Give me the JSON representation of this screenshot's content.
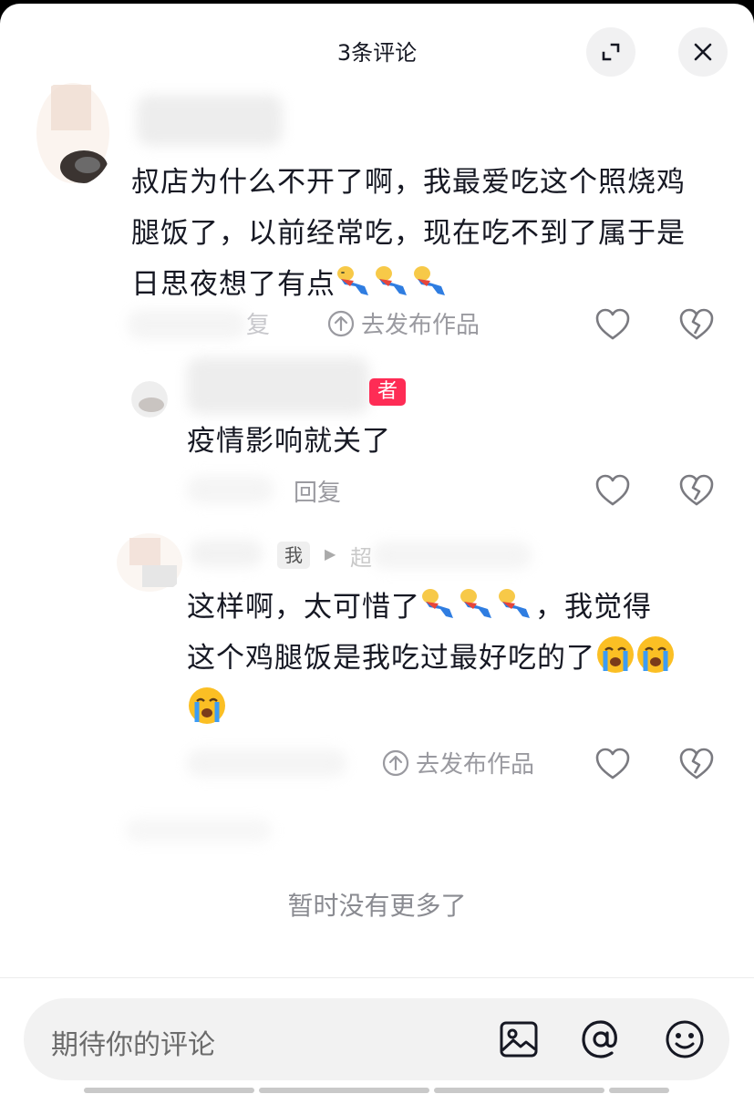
{
  "header": {
    "title": "3条评论"
  },
  "comments": [
    {
      "text": "叔店为什么不开了啊，我最爱吃这个照烧鸡腿饭了，以前经常吃，现在吃不到了属于是日思夜想了有点",
      "lines": [
        "叔店为什么不开了啊，我最爱吃这个照烧鸡",
        "腿饭了，以前经常吃，现在吃不到了属于是",
        "日思夜想了有点"
      ],
      "reply_label": "复",
      "publish_label": "去发布作品"
    },
    {
      "author_badge": "者",
      "text": "疫情影响就关了",
      "reply_label": "回复"
    },
    {
      "me_tag": "我",
      "reply_to_fragment": "超",
      "lines": [
        "这样啊，太可惜了",
        "，我觉得",
        "这个鸡腿饭是我吃过最好吃的了"
      ],
      "publish_label": "去发布作品"
    }
  ],
  "footer_note": "暂时没有更多了",
  "input": {
    "placeholder": "期待你的评论"
  },
  "icons": [
    "expand-icon",
    "close-icon",
    "publish-icon",
    "like-icon",
    "dislike-icon",
    "image-icon",
    "at-icon",
    "emoji-icon"
  ],
  "colors": {
    "accent": "#fe2c55",
    "text": "#161823",
    "muted": "#9a9aa0"
  }
}
